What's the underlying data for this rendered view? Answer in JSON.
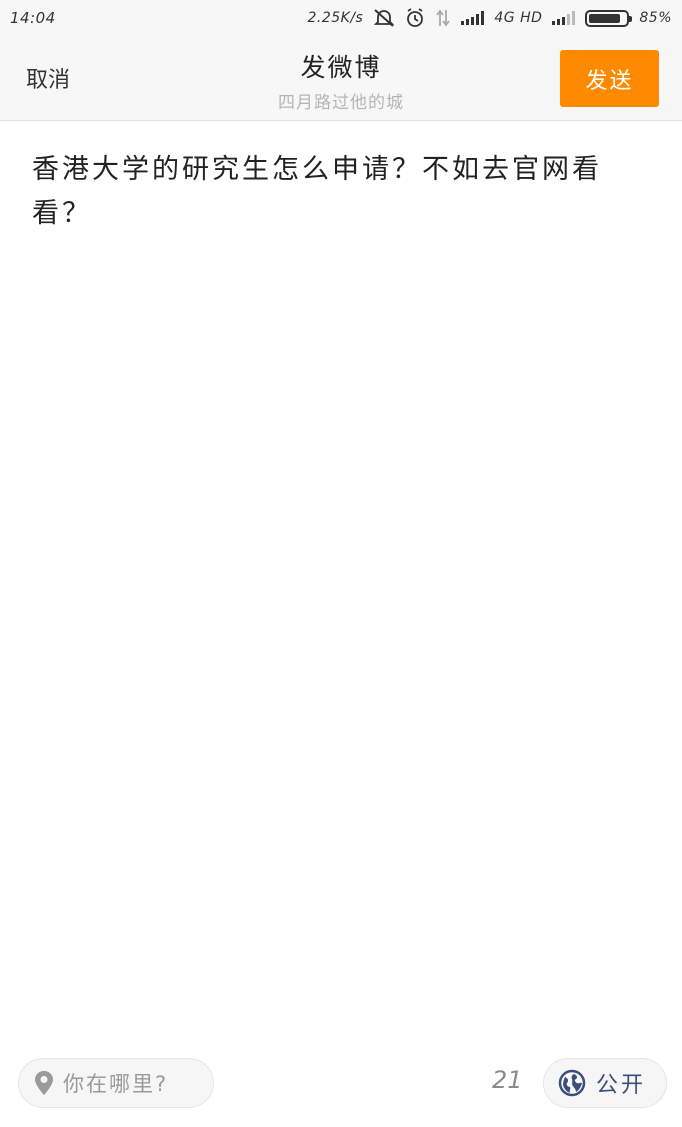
{
  "status_bar": {
    "time": "14:04",
    "net_speed": "2.25K/s",
    "network_label": "4G HD",
    "battery": "85%",
    "battery_level": 0.85
  },
  "header": {
    "cancel_label": "取消",
    "title": "发微博",
    "subtitle": "四月路过他的城",
    "send_label": "发送"
  },
  "compose": {
    "text": "香港大学的研究生怎么申请？不如去官网看看？"
  },
  "footer": {
    "location_placeholder": "你在哪里?",
    "char_count": "21",
    "visibility_label": "公开"
  },
  "colors": {
    "accent": "#ff8a00",
    "visibility": "#3b4f7a"
  },
  "icons": [
    "mute-icon",
    "alarm-icon",
    "data-arrows-icon",
    "signal-icon",
    "battery-icon",
    "location-pin-icon",
    "globe-icon"
  ]
}
